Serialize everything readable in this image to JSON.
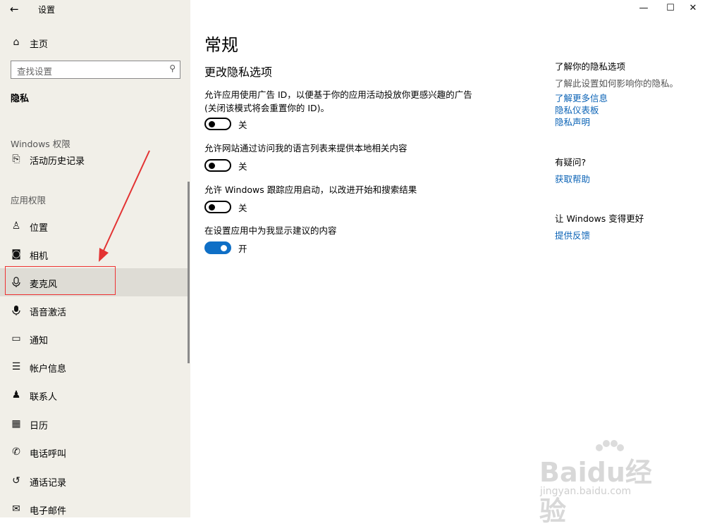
{
  "app": {
    "title": "设置",
    "back_glyph": "←"
  },
  "window_controls": {
    "minimize": "—",
    "maximize": "☐",
    "close": "✕"
  },
  "sidebar": {
    "home_label": "主页",
    "search_placeholder": "查找设置",
    "current_section": "隐私",
    "groups": [
      "Windows 权限",
      "应用权限"
    ],
    "items": [
      {
        "label": "活动历史记录",
        "icon": "activity-history-icon",
        "glyph": "⎘"
      },
      {
        "label": "位置",
        "icon": "location-icon",
        "glyph": "♙"
      },
      {
        "label": "相机",
        "icon": "camera-icon",
        "glyph": "◙"
      },
      {
        "label": "麦克风",
        "icon": "microphone-icon",
        "glyph": "🎙"
      },
      {
        "label": "语音激活",
        "icon": "voice-activation-icon",
        "glyph": "🎤"
      },
      {
        "label": "通知",
        "icon": "notification-icon",
        "glyph": "▭"
      },
      {
        "label": "帐户信息",
        "icon": "account-info-icon",
        "glyph": "☰"
      },
      {
        "label": "联系人",
        "icon": "contacts-icon",
        "glyph": "♟"
      },
      {
        "label": "日历",
        "icon": "calendar-icon",
        "glyph": "▦"
      },
      {
        "label": "电话呼叫",
        "icon": "phone-icon",
        "glyph": "✆"
      },
      {
        "label": "通话记录",
        "icon": "call-history-icon",
        "glyph": "↺"
      },
      {
        "label": "电子邮件",
        "icon": "email-icon",
        "glyph": "✉"
      }
    ],
    "selected_item": "麦克风"
  },
  "main": {
    "title": "常规",
    "subtitle": "更改隐私选项",
    "options": [
      {
        "text": "允许应用使用广告 ID，以便基于你的应用活动投放你更感兴趣的广告(关闭该模式将会重置你的 ID)。",
        "state": "关",
        "on": false
      },
      {
        "text": "允许网站通过访问我的语言列表来提供本地相关内容",
        "state": "关",
        "on": false
      },
      {
        "text": "允许 Windows 跟踪应用启动，以改进开始和搜索结果",
        "state": "关",
        "on": false
      },
      {
        "text": "在设置应用中为我显示建议的内容",
        "state": "开",
        "on": true
      }
    ]
  },
  "right": {
    "privacy_title": "了解你的隐私选项",
    "privacy_text": "了解此设置如何影响你的隐私。",
    "links": [
      "了解更多信息",
      "隐私仪表板",
      "隐私声明"
    ],
    "question_title": "有疑问?",
    "help_link": "获取帮助",
    "improve_title": "让 Windows 变得更好",
    "feedback_link": "提供反馈"
  },
  "watermark": {
    "logo": "Baidu经验",
    "url": "jingyan.baidu.com"
  },
  "colors": {
    "accent": "#0f6fc6",
    "link": "#0b63b6",
    "sidebar_bg": "#f1efe8",
    "annotation": "#e33333"
  }
}
